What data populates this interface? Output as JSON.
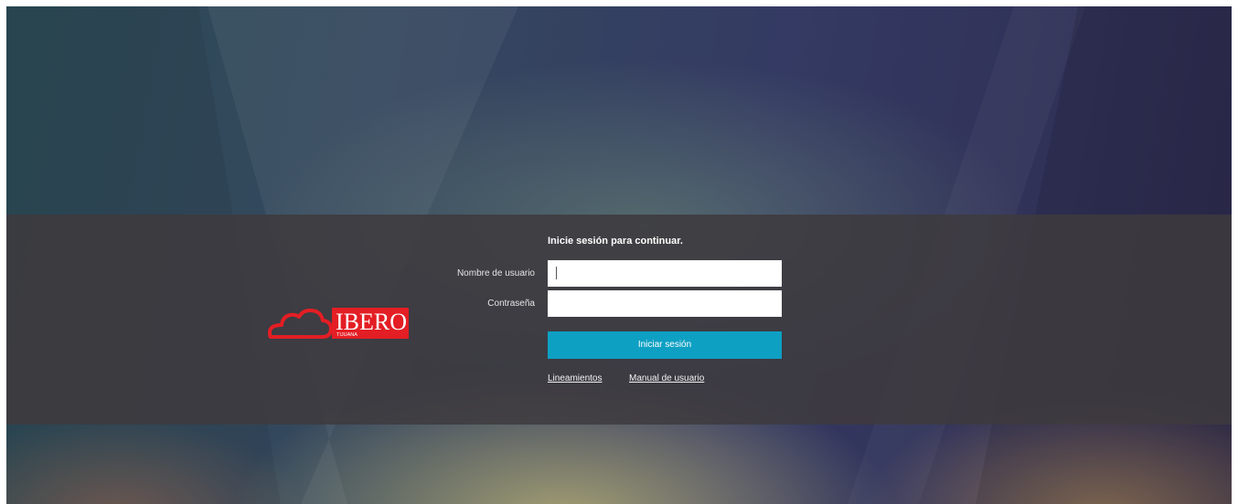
{
  "brand": {
    "name": "IBERO",
    "sub": "TIJUANA",
    "colors": {
      "red": "#e31e24",
      "accent": "#0ea0c3",
      "panel": "#3e3a3e"
    },
    "icon": "cloud-icon"
  },
  "login": {
    "title": "Inicie sesión para continuar.",
    "username_label": "Nombre de usuario",
    "username_value": "",
    "password_label": "Contraseña",
    "password_value": "",
    "submit_label": "Iniciar sesión"
  },
  "links": {
    "guidelines": "Lineamientos",
    "manual": "Manual de usuario"
  }
}
